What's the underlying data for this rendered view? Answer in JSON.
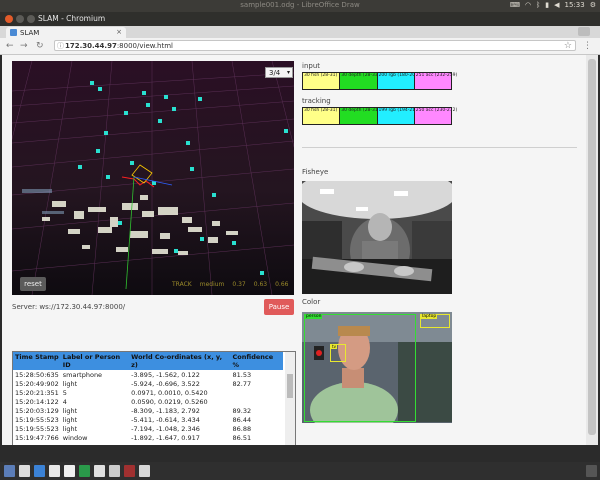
{
  "os": {
    "window_title": "sample001.odg - LibreOffice Draw",
    "clock": "15:33"
  },
  "browser": {
    "window_title": "SLAM - Chromium",
    "tab_label": "SLAM",
    "tab_close": "×",
    "url": "172.30.44.97:8000/view.html",
    "url_host": "172.30.44.97",
    "url_rest": ":8000/view.html"
  },
  "viewer": {
    "select_value": "3/4",
    "reset_label": "reset",
    "readouts": [
      "TRACK",
      "medium",
      "0.37",
      "0.63",
      "0.66"
    ]
  },
  "server": {
    "label": "Server: ws://172.30.44.97:8000/",
    "pause_label": "Pause"
  },
  "input": {
    "label": "input",
    "swatches": [
      {
        "label": "30 fish (28-31)",
        "color": "#ffff88"
      },
      {
        "label": "30 depth (28-33)",
        "color": "#22dd22"
      },
      {
        "label": "200 rgb (180-203)",
        "color": "#22eeff"
      },
      {
        "label": "251 acc (232-259)",
        "color": "#ff88ff"
      }
    ]
  },
  "tracking": {
    "label": "tracking",
    "swatches": [
      {
        "label": "30 fish (28-31)",
        "color": "#ffff88"
      },
      {
        "label": "30 depth (28-31)",
        "color": "#22dd22"
      },
      {
        "label": "199 rgb (194-217)",
        "color": "#22eeff"
      },
      {
        "label": "250 acc (230-272)",
        "color": "#ff88ff"
      }
    ]
  },
  "fisheye": {
    "label": "Fisheye"
  },
  "color": {
    "label": "Color",
    "detections": [
      "laptop",
      "person",
      "tv"
    ]
  },
  "table": {
    "headers": [
      "Time Stamp",
      "Label or Person ID",
      "World Co-ordinates (x, y, z)",
      "Confidence %"
    ],
    "rows": [
      [
        "15:28:50:635",
        "smartphone",
        "-3.895, -1.562, 0.122",
        "81.53"
      ],
      [
        "15:20:49:902",
        "light",
        "-5.924, -0.696, 3.522",
        "82.77"
      ],
      [
        "15:20:21:351",
        "5",
        "0.0971, 0.0010, 0.5420",
        ""
      ],
      [
        "15:20:14:122",
        "4",
        "0.0590, 0.0219, 0.5260",
        ""
      ],
      [
        "15:20:03:129",
        "light",
        "-8.309, -1.183, 2.792",
        "89.32"
      ],
      [
        "15:19:55:523",
        "light",
        "-5.411, -0.614, 3.434",
        "86.44"
      ],
      [
        "15:19:55:523",
        "light",
        "-7.194, -1.048, 2.346",
        "86.88"
      ],
      [
        "15:19:47:766",
        "window",
        "-1.892, -1.647, 0.917",
        "86.51"
      ]
    ]
  },
  "colors": {
    "pause": "#e05a5a",
    "table_header": "#3d8fe0",
    "map_points": "#29e0d0"
  }
}
